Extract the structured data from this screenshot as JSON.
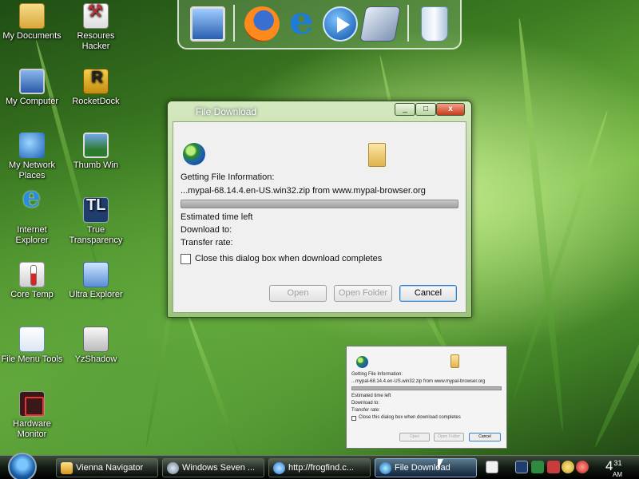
{
  "desktop": {
    "icons": [
      {
        "label": "My Documents",
        "icon": "folder-icon"
      },
      {
        "label": "Resoures Hacker",
        "icon": "hammer-icon"
      },
      {
        "label": "My Computer",
        "icon": "computer-icon"
      },
      {
        "label": "RocketDock",
        "icon": "rocketdock-icon"
      },
      {
        "label": "My Network Places",
        "icon": "network-icon"
      },
      {
        "label": "Thumb Win",
        "icon": "thumb-win-icon"
      },
      {
        "label": "Internet Explorer",
        "icon": "internet-explorer-icon"
      },
      {
        "label": "True Transparency",
        "icon": "true-transparency-icon"
      },
      {
        "label": "Core Temp",
        "icon": "thermometer-icon"
      },
      {
        "label": "Ultra Explorer",
        "icon": "ultra-explorer-icon"
      },
      {
        "label": "File Menu Tools",
        "icon": "file-menu-tools-icon"
      },
      {
        "label": "YzShadow",
        "icon": "yzshadow-icon"
      },
      {
        "label": "Hardware Monitor",
        "icon": "hardware-monitor-icon"
      }
    ]
  },
  "dock": {
    "items": [
      "my-computer-icon",
      "firefox-icon",
      "internet-explorer-icon",
      "media-player-icon",
      "drive-icon",
      "recycle-bin-icon"
    ]
  },
  "dialog": {
    "title": "File Download",
    "controls": [
      "_",
      "□",
      "x"
    ],
    "status": "Getting File Information:",
    "file": "...mypal-68.14.4.en-US.win32.zip from www.mypal-browser.org",
    "progress": 1.0,
    "estimated_time_label": "Estimated time left",
    "download_to_label": "Download to:",
    "transfer_rate_label": "Transfer rate:",
    "close_checkbox_label": "Close this dialog box when download completes",
    "close_checkbox_checked": false,
    "buttons": {
      "open": "Open",
      "open_folder": "Open Folder",
      "cancel": "Cancel"
    }
  },
  "preview": {
    "status": "Getting File Information:",
    "file": "...mypal-68.14.4.en-US.win32.zip from www.mypal-browser.org",
    "estimated_time_label": "Estimated time left",
    "download_to_label": "Download to:",
    "transfer_rate_label": "Transfer rate:",
    "close_checkbox_label": "Close this dialog box when download completes",
    "buttons": {
      "open": "Open",
      "open_folder": "Open Folder",
      "cancel": "Cancel"
    }
  },
  "taskbar": {
    "buttons": [
      {
        "label": "Vienna Navigator",
        "icon": "vienna-icon",
        "active": false
      },
      {
        "label": "Windows Seven ...",
        "icon": "window-icon",
        "active": false
      },
      {
        "label": "http://frogfind.c...",
        "icon": "internet-explorer-icon",
        "active": false
      },
      {
        "label": "File Download",
        "icon": "download-icon",
        "active": true
      }
    ],
    "clock_hour": "4",
    "clock_min": "31",
    "clock_period": "AM"
  },
  "colors": {
    "accent": "#3a7ec4",
    "grass_dark": "#1f4d14",
    "grass_light": "#a9e06a"
  }
}
